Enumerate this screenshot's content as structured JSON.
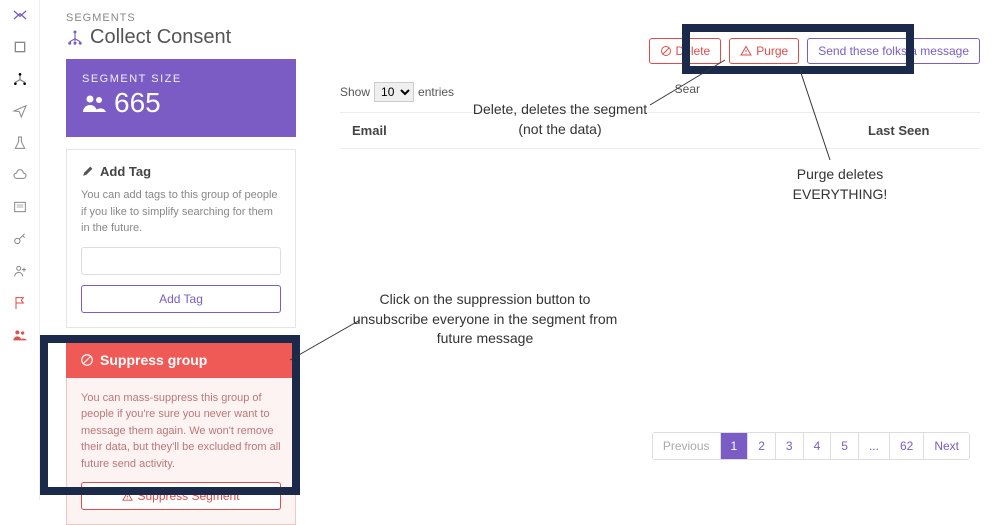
{
  "crumb": "SEGMENTS",
  "page_title": "Collect Consent",
  "seg_size_label": "SEGMENT SIZE",
  "seg_size_count": "665",
  "add_tag": {
    "title": "Add Tag",
    "desc": "You can add tags to this group of people if you like to simplify searching for them in the future.",
    "button": "Add Tag"
  },
  "suppress": {
    "title": "Suppress group",
    "desc": "You can mass-suppress this group of people if you're sure you never want to message them again. We won't remove their data, but they'll be excluded from all future send activity.",
    "button": "Suppress Segment"
  },
  "actions": {
    "delete": "Delete",
    "purge": "Purge",
    "send": "Send these folks a message"
  },
  "table": {
    "show": "Show",
    "entries": "entries",
    "per_page": "10",
    "search_label": "Sear",
    "col_email": "Email",
    "col_last": "Last Seen"
  },
  "pager": {
    "prev": "Previous",
    "pages": [
      "1",
      "2",
      "3",
      "4",
      "5",
      "...",
      "62"
    ],
    "next": "Next",
    "current": 0
  },
  "annotations": {
    "suppress": "Click on the suppression button to unsubscribe everyone in the segment from future message",
    "delete": "Delete, deletes the segment (not the data)",
    "purge": "Purge deletes EVERYTHING!"
  }
}
